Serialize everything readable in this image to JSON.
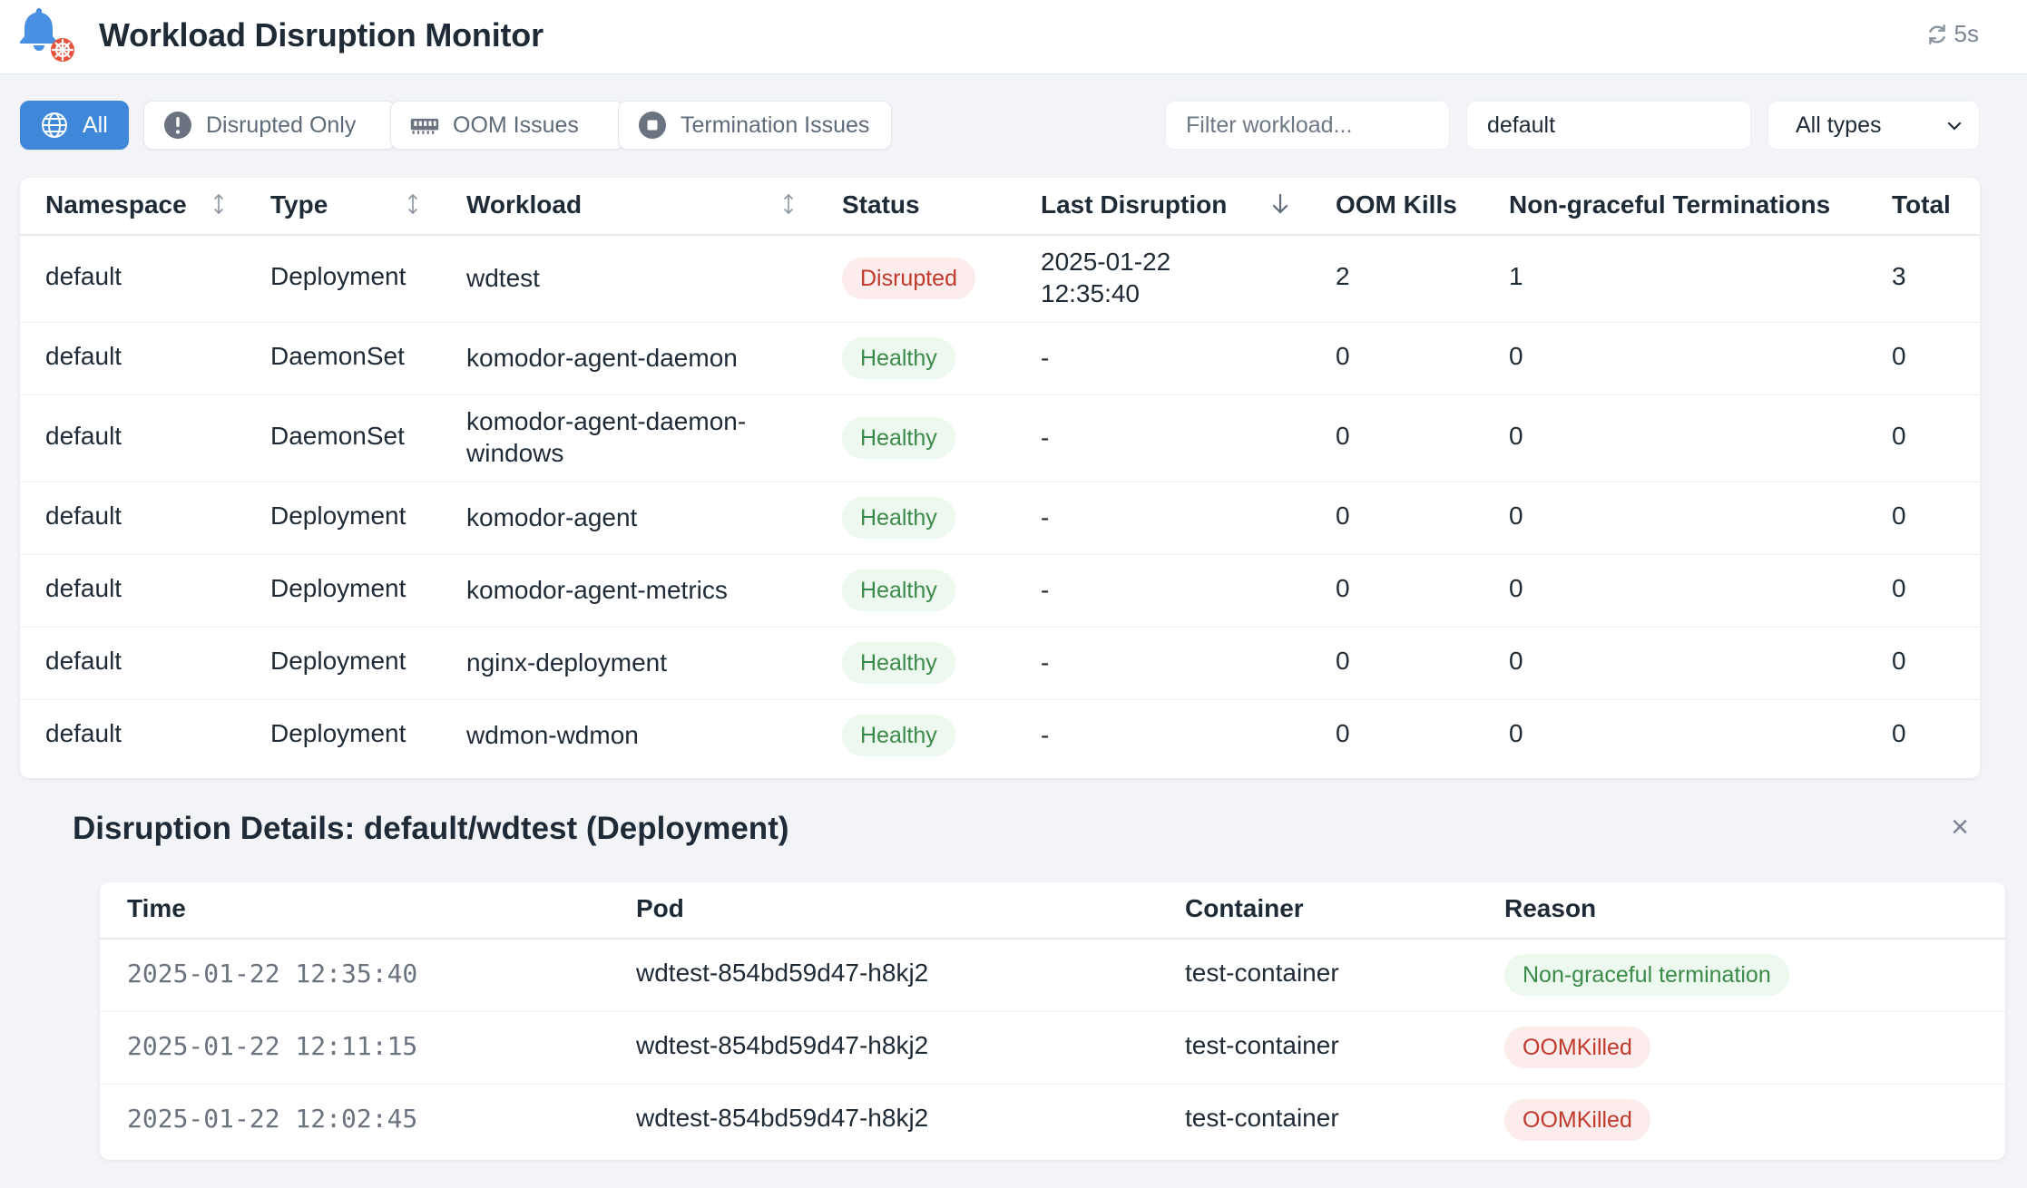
{
  "header": {
    "title": "Workload Disruption Monitor",
    "logo_icon": "bell-with-helm-icon",
    "refresh_interval": "5s"
  },
  "filters": {
    "buttons": [
      {
        "label": "All",
        "icon": "globe-icon",
        "active": true
      },
      {
        "label": "Disrupted Only",
        "icon": "exclamation-circle-icon",
        "active": false
      },
      {
        "label": "OOM Issues",
        "icon": "memory-icon",
        "active": false
      },
      {
        "label": "Termination Issues",
        "icon": "stop-circle-icon",
        "active": false
      }
    ],
    "workload_filter": {
      "placeholder": "Filter workload...",
      "value": ""
    },
    "namespace_filter": {
      "value": "default"
    },
    "type_select": {
      "value": "All types"
    }
  },
  "workloads": {
    "columns": [
      "Namespace",
      "Type",
      "Workload",
      "Status",
      "Last Disruption",
      "OOM Kills",
      "Non-graceful Terminations",
      "Total"
    ],
    "rows": [
      {
        "namespace": "default",
        "type": "Deployment",
        "workload": "wdtest",
        "status": "Disrupted",
        "last_disruption": [
          "2025-01-22",
          "12:35:40"
        ],
        "oom_kills": "2",
        "terminations": "1",
        "total": "3"
      },
      {
        "namespace": "default",
        "type": "DaemonSet",
        "workload": "komodor-agent-daemon",
        "status": "Healthy",
        "last_disruption": [
          "-"
        ],
        "oom_kills": "0",
        "terminations": "0",
        "total": "0"
      },
      {
        "namespace": "default",
        "type": "DaemonSet",
        "workload": "komodor-agent-daemon-windows",
        "workload_lines": [
          "komodor-agent-daemon-",
          "windows"
        ],
        "status": "Healthy",
        "last_disruption": [
          "-"
        ],
        "oom_kills": "0",
        "terminations": "0",
        "total": "0"
      },
      {
        "namespace": "default",
        "type": "Deployment",
        "workload": "komodor-agent",
        "status": "Healthy",
        "last_disruption": [
          "-"
        ],
        "oom_kills": "0",
        "terminations": "0",
        "total": "0"
      },
      {
        "namespace": "default",
        "type": "Deployment",
        "workload": "komodor-agent-metrics",
        "status": "Healthy",
        "last_disruption": [
          "-"
        ],
        "oom_kills": "0",
        "terminations": "0",
        "total": "0"
      },
      {
        "namespace": "default",
        "type": "Deployment",
        "workload": "nginx-deployment",
        "status": "Healthy",
        "last_disruption": [
          "-"
        ],
        "oom_kills": "0",
        "terminations": "0",
        "total": "0"
      },
      {
        "namespace": "default",
        "type": "Deployment",
        "workload": "wdmon-wdmon",
        "status": "Healthy",
        "last_disruption": [
          "-"
        ],
        "oom_kills": "0",
        "terminations": "0",
        "total": "0"
      }
    ]
  },
  "details": {
    "title": "Disruption Details: default/wdtest (Deployment)",
    "close_label": "×",
    "columns": [
      "Time",
      "Pod",
      "Container",
      "Reason"
    ],
    "rows": [
      {
        "time": "2025-01-22 12:35:40",
        "pod": "wdtest-854bd59d47-h8kj2",
        "container": "test-container",
        "reason": "Non-graceful termination"
      },
      {
        "time": "2025-01-22 12:11:15",
        "pod": "wdtest-854bd59d47-h8kj2",
        "container": "test-container",
        "reason": "OOMKilled"
      },
      {
        "time": "2025-01-22 12:02:45",
        "pod": "wdtest-854bd59d47-h8kj2",
        "container": "test-container",
        "reason": "OOMKilled"
      }
    ]
  },
  "colors": {
    "accent": "#3f87d9",
    "healthy_bg": "#edf8ee",
    "healthy_text": "#3a8a4a",
    "danger_bg": "#fdecec",
    "danger_text": "#c0392b"
  }
}
